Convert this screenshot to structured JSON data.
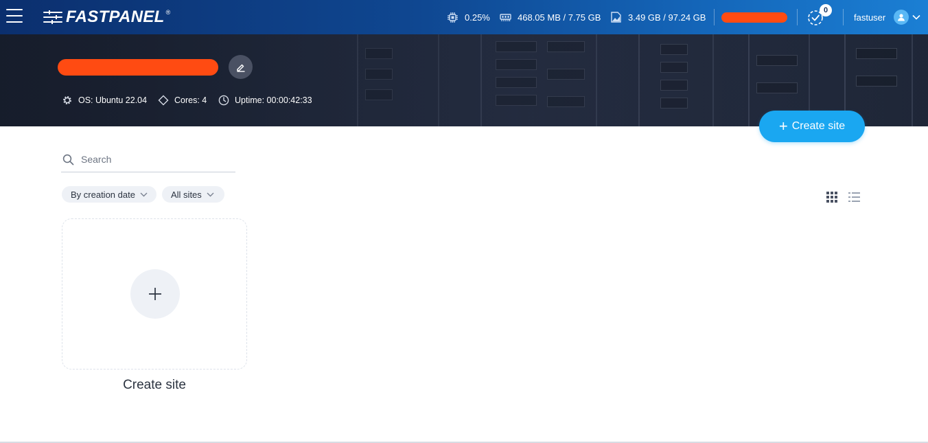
{
  "app": {
    "brand": "FASTPANEL",
    "brand_mark": "®"
  },
  "header": {
    "stats": {
      "cpu": "0.25%",
      "ram": "468.05 MB / 7.75 GB",
      "disk": "3.49 GB / 97.24 GB"
    },
    "tasks_count": "0",
    "username": "fastuser"
  },
  "server": {
    "name_redacted": true,
    "os": "OS: Ubuntu 22.04",
    "cores": "Cores: 4",
    "uptime": "Uptime: 00:00:42:33"
  },
  "actions": {
    "create_site": "Create site"
  },
  "search": {
    "placeholder": "Search",
    "value": ""
  },
  "filters": {
    "sort": "By creation date",
    "scope": "All sites"
  },
  "cards": {
    "new_site_label": "Create site"
  },
  "colors": {
    "accent": "#1aa7f1",
    "redaction": "#ff4b12",
    "header_start": "#0b2f6e",
    "header_end": "#1b7fd4"
  }
}
